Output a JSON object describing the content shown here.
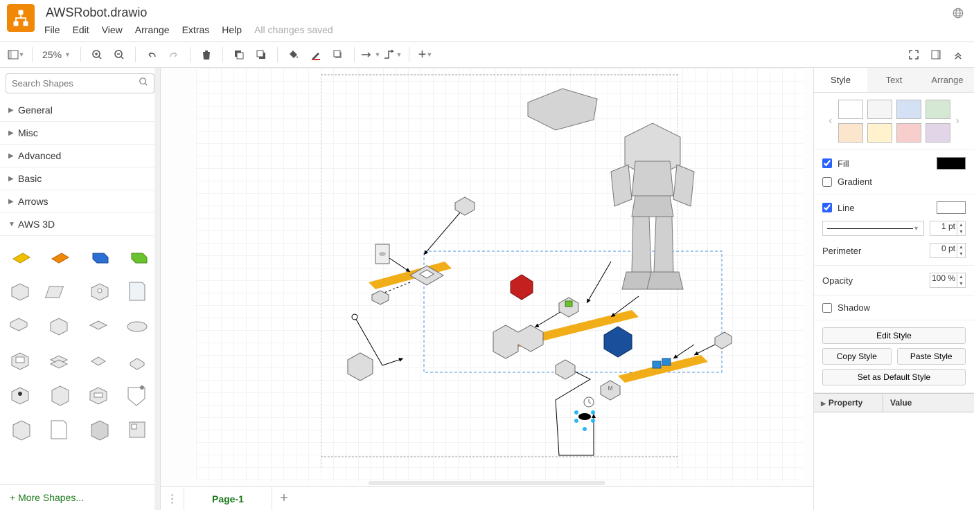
{
  "header": {
    "title": "AWSRobot.drawio",
    "menus": [
      "File",
      "Edit",
      "View",
      "Arrange",
      "Extras",
      "Help"
    ],
    "status": "All changes saved"
  },
  "toolbar": {
    "zoom": "25%"
  },
  "search": {
    "placeholder": "Search Shapes"
  },
  "categories": [
    "General",
    "Misc",
    "Advanced",
    "Basic",
    "Arrows",
    "AWS 3D"
  ],
  "more_shapes": "+ More Shapes...",
  "pages": {
    "tab1": "Page-1"
  },
  "right": {
    "tabs": [
      "Style",
      "Text",
      "Arrange"
    ],
    "swatches": [
      "#ffffff",
      "#f5f5f5",
      "#d4e1f5",
      "#d4e8d4",
      "#fce5cd",
      "#fff2cc",
      "#f8cecc",
      "#e1d5e7"
    ],
    "fill_label": "Fill",
    "fill_on": true,
    "fill_color": "#000000",
    "gradient_label": "Gradient",
    "gradient_on": false,
    "line_label": "Line",
    "line_on": true,
    "line_color": "#ffffff",
    "line_weight": "1 pt",
    "perimeter_label": "Perimeter",
    "perimeter_val": "0 pt",
    "opacity_label": "Opacity",
    "opacity_val": "100 %",
    "shadow_label": "Shadow",
    "shadow_on": false,
    "edit_style": "Edit Style",
    "copy_style": "Copy Style",
    "paste_style": "Paste Style",
    "default_style": "Set as Default Style",
    "prop_label": "Property",
    "value_label": "Value"
  }
}
